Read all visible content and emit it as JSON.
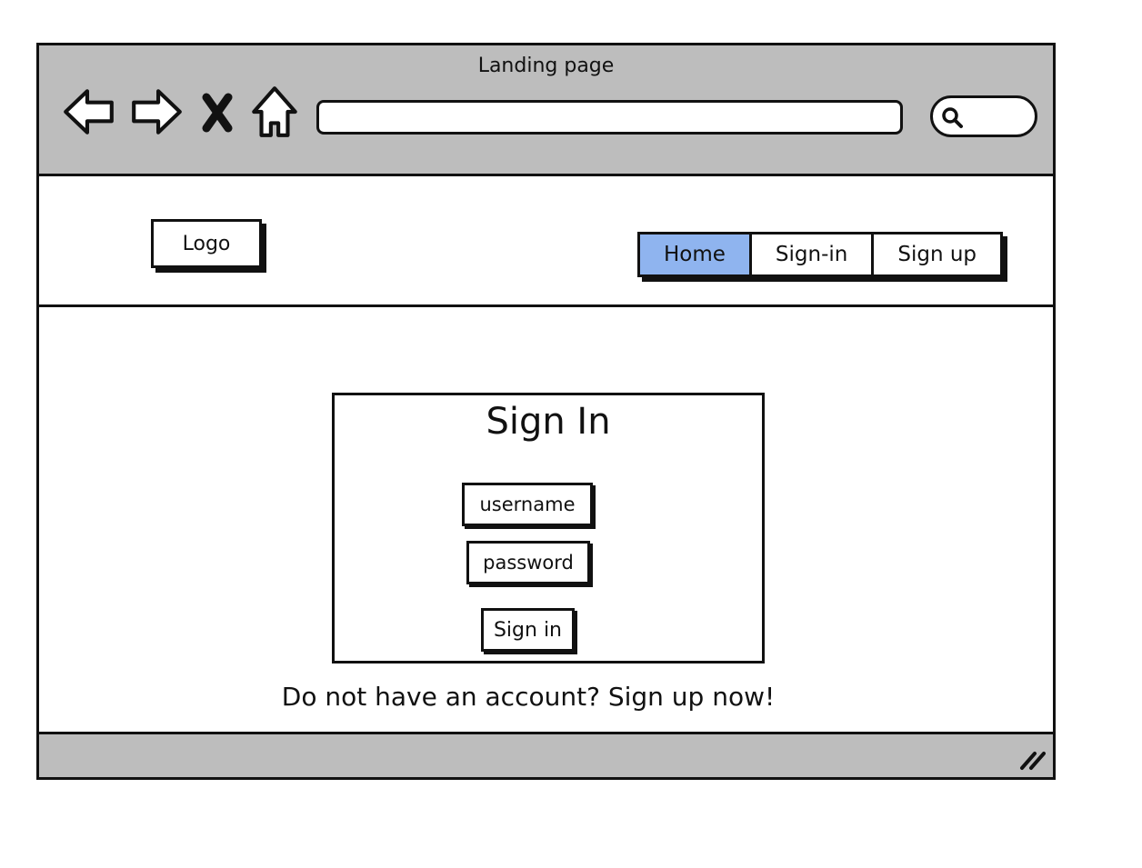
{
  "window": {
    "title": "Landing page"
  },
  "toolbar": {
    "icons": [
      "back-arrow-icon",
      "forward-arrow-icon",
      "close-icon",
      "home-icon",
      "search-icon"
    ],
    "url_value": "",
    "search_value": ""
  },
  "header": {
    "logo": "Logo",
    "tabs": [
      {
        "label": "Home",
        "active": true
      },
      {
        "label": "Sign-in",
        "active": false
      },
      {
        "label": "Sign up",
        "active": false
      }
    ]
  },
  "signin": {
    "title": "Sign In",
    "username_label": "username",
    "password_label": "password",
    "submit_label": "Sign in"
  },
  "footer_text": "Do not have an account? Sign up now!",
  "colors": {
    "chrome_gray": "#bdbdbd",
    "active_tab": "#8fb4ef",
    "stroke": "#111111"
  }
}
